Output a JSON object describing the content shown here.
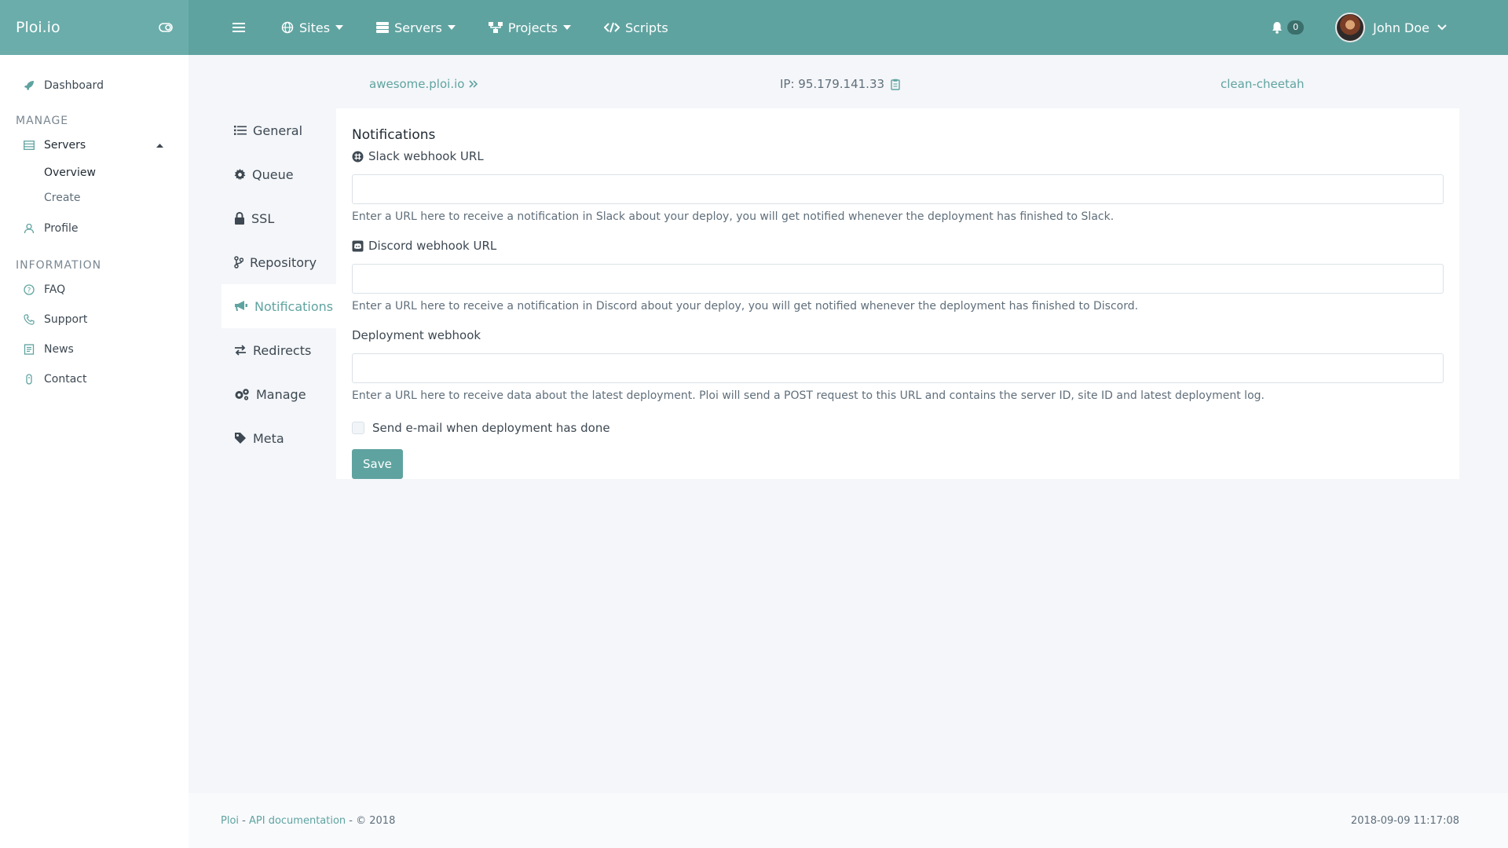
{
  "brand": {
    "title": "Ploi.io"
  },
  "topnav": {
    "sites": "Sites",
    "servers": "Servers",
    "projects": "Projects",
    "scripts": "Scripts",
    "notification_count": "0",
    "user_name": "John Doe"
  },
  "sidebar": {
    "dashboard": "Dashboard",
    "manage_heading": "MANAGE",
    "servers": "Servers",
    "overview": "Overview",
    "create": "Create",
    "profile": "Profile",
    "information_heading": "INFORMATION",
    "faq": "FAQ",
    "support": "Support",
    "news": "News",
    "contact": "Contact"
  },
  "infobar": {
    "site": "awesome.ploi.io",
    "ip": "IP: 95.179.141.33",
    "server": "clean-cheetah"
  },
  "subnav": {
    "general": "General",
    "queue": "Queue",
    "ssl": "SSL",
    "repository": "Repository",
    "notifications": "Notifications",
    "redirects": "Redirects",
    "manage": "Manage",
    "meta": "Meta"
  },
  "form": {
    "title": "Notifications",
    "slack_label": "Slack webhook URL",
    "slack_value": "",
    "slack_help": "Enter a URL here to receive a notification in Slack about your deploy, you will get notified whenever the deployment has finished to Slack.",
    "discord_label": "Discord webhook URL",
    "discord_value": "",
    "discord_help": "Enter a URL here to receive a notification in Discord about your deploy, you will get notified whenever the deployment has finished to Discord.",
    "deploy_label": "Deployment webhook",
    "deploy_value": "",
    "deploy_help": "Enter a URL here to receive data about the latest deployment. Ploi will send a POST request to this URL and contains the server ID, site ID and latest deployment log.",
    "email_checkbox_label": "Send e-mail when deployment has done",
    "save": "Save"
  },
  "footer": {
    "ploi": "Ploi",
    "sep1": " - ",
    "api_docs": "API documentation",
    "copyright": " - © 2018",
    "timestamp": "2018-09-09 11:17:08"
  },
  "colors": {
    "accent": "#5fa3a0",
    "brand_bg": "#6aadaa"
  }
}
